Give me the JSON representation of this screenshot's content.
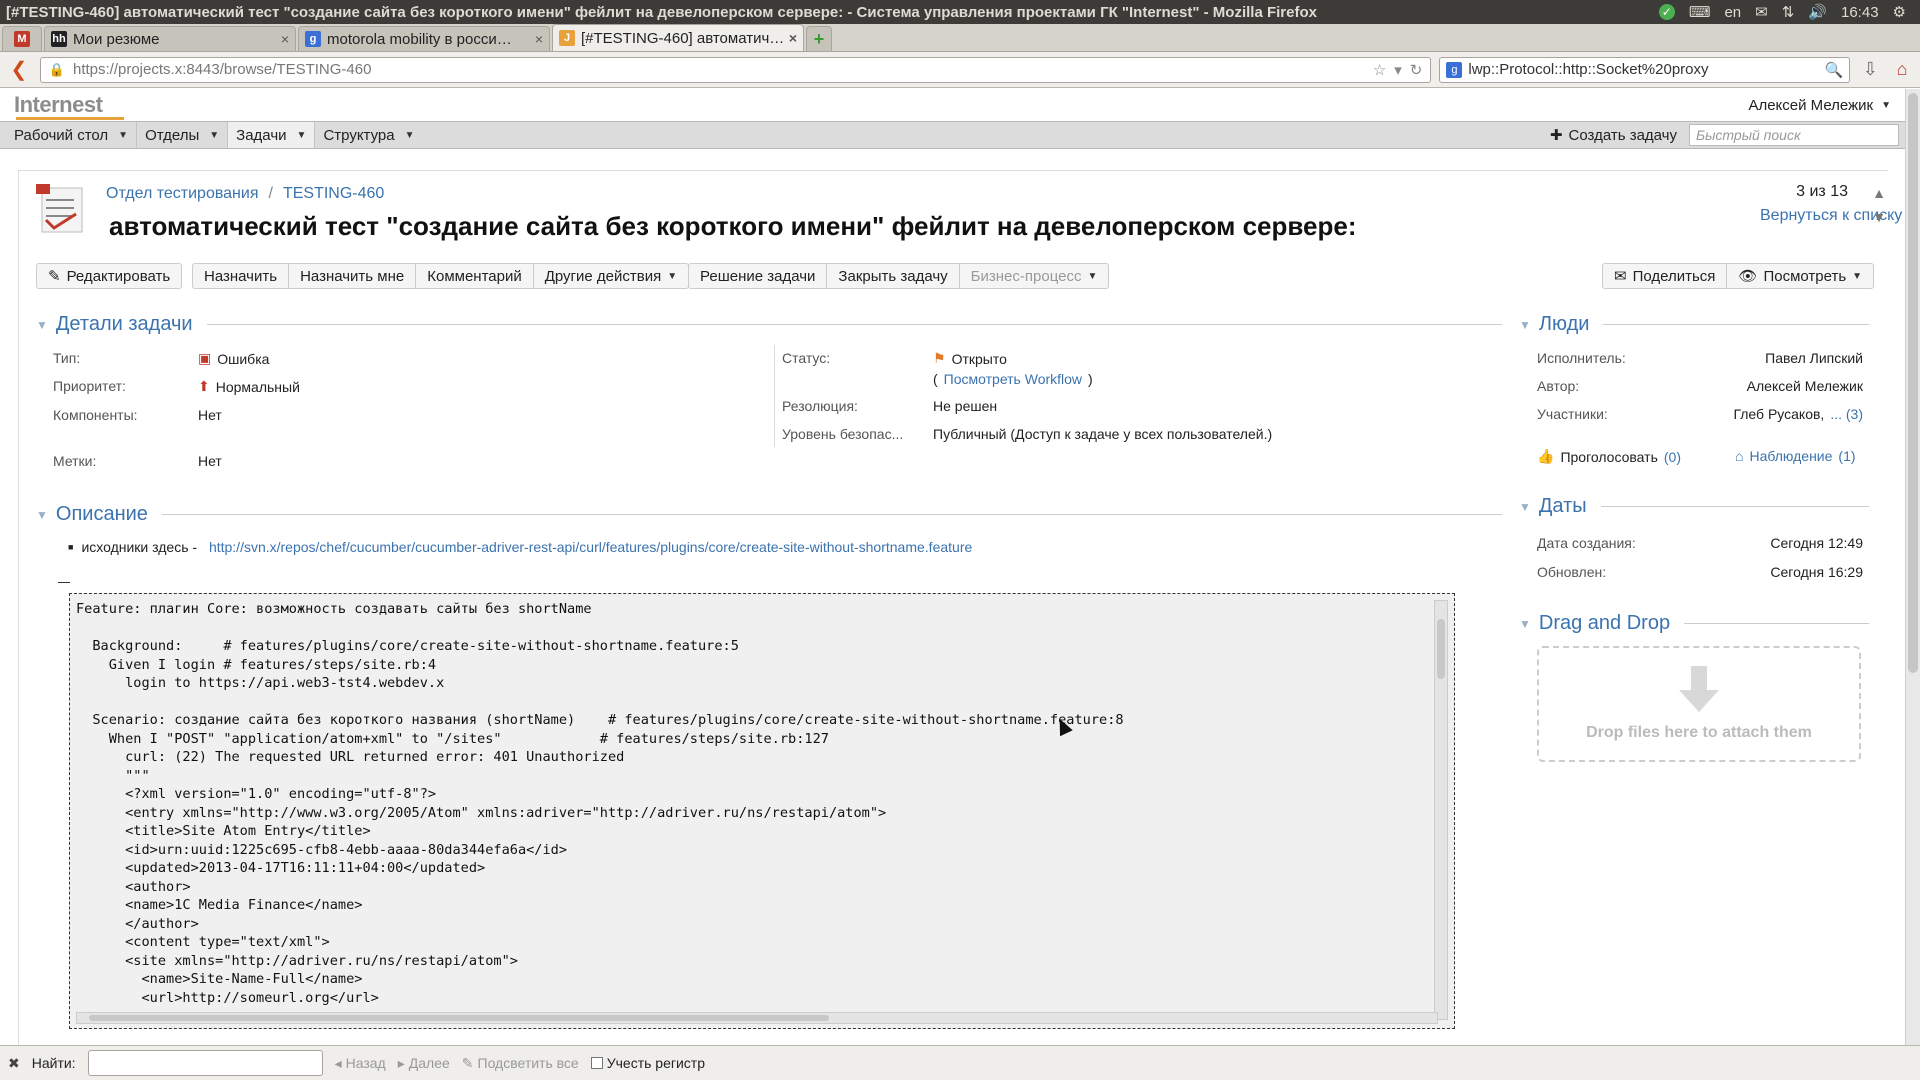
{
  "window": {
    "title": "[#TESTING-460] автоматический тест \"создание сайта без короткого имени\" фейлит на девелоперском сервере: - Система управления проектами ГК \"Internest\" - Mozilla Firefox",
    "tray": {
      "lang": "en",
      "time": "16:43"
    }
  },
  "tabs": [
    {
      "label": "Мои резюме",
      "icon": "hh-icon",
      "color": "#222222"
    },
    {
      "label": "motorola mobility в росси…",
      "icon": "google-icon",
      "color": "#3b6fd8"
    },
    {
      "label": "[#TESTING-460] автоматич…",
      "icon": "jira-icon",
      "color": "#e7a23b",
      "active": true
    }
  ],
  "nav": {
    "url": "https://projects.x:8443/browse/TESTING-460",
    "search_value": "lwp::Protocol::http::Socket%20proxy"
  },
  "header": {
    "logo": "Internest",
    "user": "Алексей Мележик"
  },
  "menu": {
    "items": [
      "Рабочий стол",
      "Отделы",
      "Задачи",
      "Структура"
    ],
    "create_label": "Создать задачу",
    "quick_placeholder": "Быстрый поиск"
  },
  "issue": {
    "project": "Отдел тестирования",
    "key": "TESTING-460",
    "summary": "автоматический тест \"создание сайта без короткого имени\" фейлит на девелоперском сервере:",
    "pager_count": "3 из 13",
    "back_to_list": "Вернуться к списку"
  },
  "toolbar": {
    "group1": [
      "Редактировать"
    ],
    "group2": [
      "Назначить",
      "Назначить мне",
      "Комментарий",
      "Другие действия"
    ],
    "group3": [
      "Решение задачи",
      "Закрыть задачу",
      "Бизнес-процесс"
    ],
    "share": "Поделиться",
    "view": "Посмотреть"
  },
  "details": {
    "title": "Детали задачи",
    "type_label": "Тип:",
    "type_value": "Ошибка",
    "priority_label": "Приоритет:",
    "priority_value": "Нормальный",
    "components_label": "Компоненты:",
    "components_value": "Нет",
    "labels_label": "Метки:",
    "labels_value": "Нет",
    "status_label": "Статус:",
    "status_value": "Открыто",
    "workflow_link": "Посмотреть Workflow",
    "resolution_label": "Резолюция:",
    "resolution_value": "Не решен",
    "security_label": "Уровень безопас...",
    "security_value": "Публичный (Доступ к задаче у всех пользователей.)"
  },
  "description": {
    "title": "Описание",
    "bullet_prefix": "исходники здесь - ",
    "bullet_link": "http://svn.x/repos/chef/cucumber/cucumber-adriver-rest-api/curl/features/plugins/core/create-site-without-shortname.feature",
    "code_lines": [
      "Feature: плагин Core: возможность создавать сайты без shortName",
      "",
      "  Background:     # features/plugins/core/create-site-without-shortname.feature:5",
      "    Given I login # features/steps/site.rb:4",
      "      login to https://api.web3-tst4.webdev.x",
      "",
      "  Scenario: создание сайта без короткого названия (shortName)    # features/plugins/core/create-site-without-shortname.feature:8",
      "    When I \"POST\" \"application/atom+xml\" to \"/sites\"            # features/steps/site.rb:127",
      "      curl: (22) The requested URL returned error: 401 Unauthorized",
      "      \"\"\"",
      "      <?xml version=\"1.0\" encoding=\"utf-8\"?>",
      "      <entry xmlns=\"http://www.w3.org/2005/Atom\" xmlns:adriver=\"http://adriver.ru/ns/restapi/atom\">",
      "      <title>Site Atom Entry</title>",
      "      <id>urn:uuid:1225c695-cfb8-4ebb-aaaa-80da344efa6a</id>",
      "      <updated>2013-04-17T16:11:11+04:00</updated>",
      "      <author>",
      "      <name>1C Media Finance</name>",
      "      </author>",
      "      <content type=\"text/xml\">",
      "      <site xmlns=\"http://adriver.ru/ns/restapi/atom\">",
      "        <name>Site-Name-Full</name>",
      "        <url>http://someurl.org</url>"
    ]
  },
  "people": {
    "title": "Люди",
    "assignee_label": "Исполнитель:",
    "assignee": "Павел Липский",
    "author_label": "Автор:",
    "author": "Алексей Мележик",
    "participants_label": "Участники:",
    "participants": "Глеб Русаков,",
    "participants_more": "... (3)",
    "vote": "Проголосовать",
    "vote_count": "(0)",
    "watch": "Наблюдение",
    "watch_count": "(1)"
  },
  "dates": {
    "title": "Даты",
    "created_label": "Дата создания:",
    "created": "Сегодня 12:49",
    "updated_label": "Обновлен:",
    "updated": "Сегодня 16:29"
  },
  "dnd": {
    "title": "Drag and Drop",
    "text": "Drop files here to attach them"
  },
  "findbar": {
    "label": "Найти:",
    "prev": "Назад",
    "next": "Далее",
    "highlight": "Подсветить все",
    "matchcase": "Учесть регистр"
  }
}
